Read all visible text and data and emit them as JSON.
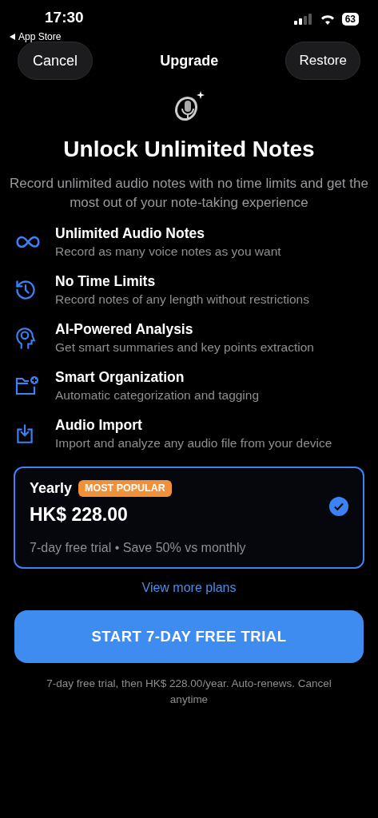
{
  "status_bar": {
    "time": "17:30",
    "back_label": "App Store",
    "battery": "63"
  },
  "nav": {
    "cancel": "Cancel",
    "title": "Upgrade",
    "restore": "Restore"
  },
  "heading": "Unlock Unlimited Notes",
  "subtitle": "Record unlimited audio notes with no time limits and get the most out of your note-taking experience",
  "features": [
    {
      "title": "Unlimited Audio Notes",
      "description": "Record as many voice notes as you want"
    },
    {
      "title": "No Time Limits",
      "description": "Record notes of any length without restrictions"
    },
    {
      "title": "AI-Powered Analysis",
      "description": "Get smart summaries and key points extraction"
    },
    {
      "title": "Smart Organization",
      "description": "Automatic categorization and tagging"
    },
    {
      "title": "Audio Import",
      "description": "Import and analyze any audio file from your device"
    }
  ],
  "plan": {
    "name": "Yearly",
    "badge": "MOST POPULAR",
    "price": "HK$ 228.00",
    "details": "7-day free trial • Save 50% vs monthly",
    "selected": true
  },
  "more_plans": "View more plans",
  "cta": "START 7-DAY FREE TRIAL",
  "footnote": "7-day free trial, then HK$ 228.00/year. Auto-renews. Cancel anytime"
}
